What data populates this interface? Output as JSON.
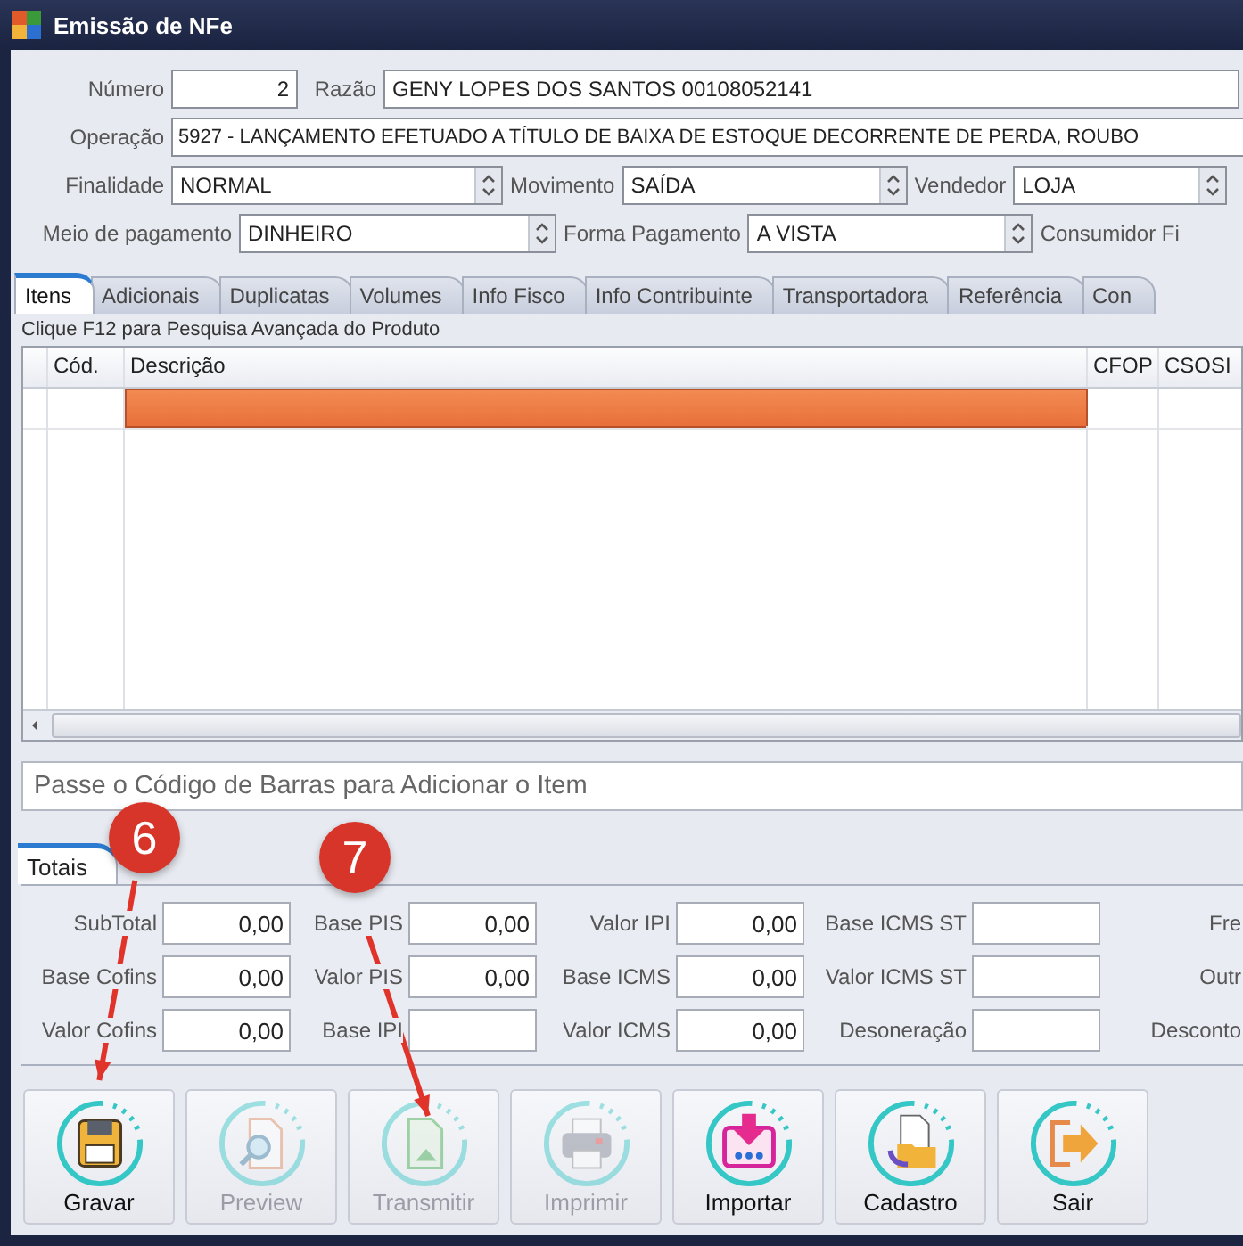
{
  "window": {
    "title": "Emissão de NFe"
  },
  "form": [
    [
      {
        "label": "Número",
        "value": "2",
        "kind": "number"
      },
      {
        "label": "Razão",
        "value": "GENY LOPES DOS SANTOS 00108052141",
        "kind": "text"
      }
    ],
    [
      {
        "label": "Operação",
        "value": "5927 - LANÇAMENTO EFETUADO A TÍTULO DE BAIXA DE ESTOQUE DECORRENTE DE PERDA, ROUBO",
        "kind": "text"
      }
    ],
    [
      {
        "label": "Finalidade",
        "value": "NORMAL",
        "kind": "select"
      },
      {
        "label": "Movimento",
        "value": "SAÍDA",
        "kind": "select"
      },
      {
        "label": "Vendedor",
        "value": "LOJA",
        "kind": "select"
      }
    ],
    [
      {
        "label": "Meio de pagamento",
        "value": "DINHEIRO",
        "kind": "select"
      },
      {
        "label": "Forma Pagamento",
        "value": "A VISTA",
        "kind": "select"
      },
      {
        "label": "Consumidor Fi",
        "kind": "label"
      }
    ]
  ],
  "tabs": [
    {
      "label": "Itens",
      "selected": true
    },
    {
      "label": "Adicionais",
      "selected": false
    },
    {
      "label": "Duplicatas",
      "selected": false
    },
    {
      "label": "Volumes",
      "selected": false
    },
    {
      "label": "Info Fisco",
      "selected": false
    },
    {
      "label": "Info Contribuinte",
      "selected": false
    },
    {
      "label": "Transportadora",
      "selected": false
    },
    {
      "label": "Referência",
      "selected": false
    },
    {
      "label": "Con",
      "selected": false
    }
  ],
  "hint": "Clique F12 para Pesquisa Avançada do Produto",
  "table": {
    "columns": [
      "Cód.",
      "Descrição",
      "CFOP",
      "CSOSI"
    ],
    "rows": [
      {
        "selected": true
      }
    ]
  },
  "barcode": {
    "placeholder": "Passe o Código de Barras  para Adicionar o Item"
  },
  "totals": {
    "tab": "Totais",
    "rows": [
      [
        {
          "label": "SubTotal",
          "value": "0,00",
          "kind": "field"
        },
        {
          "label": "Base PIS",
          "value": "0,00",
          "kind": "field"
        },
        {
          "label": "Valor IPI",
          "value": "0,00",
          "kind": "field"
        },
        {
          "label": "Base ICMS ST",
          "kind": "field"
        },
        {
          "label": "Fre",
          "kind": "label"
        }
      ],
      [
        {
          "label": "Base Cofins",
          "value": "0,00",
          "kind": "field"
        },
        {
          "label": "Valor PIS",
          "value": "0,00",
          "kind": "field"
        },
        {
          "label": "Base ICMS",
          "value": "0,00",
          "kind": "field"
        },
        {
          "label": "Valor ICMS ST",
          "kind": "field"
        },
        {
          "label": "Outr",
          "kind": "label"
        }
      ],
      [
        {
          "label": "Valor Cofins",
          "value": "0,00",
          "kind": "field"
        },
        {
          "label": "Base IPI",
          "kind": "field"
        },
        {
          "label": "Valor ICMS",
          "value": "0,00",
          "kind": "field"
        },
        {
          "label": "Desoneração",
          "kind": "field"
        },
        {
          "label": "Desconto",
          "kind": "label"
        }
      ]
    ]
  },
  "buttons": [
    {
      "label": "Gravar",
      "disabled": false
    },
    {
      "label": "Preview",
      "disabled": true
    },
    {
      "label": "Transmitir",
      "disabled": true
    },
    {
      "label": "Imprimir",
      "disabled": true
    },
    {
      "label": "Importar",
      "disabled": false
    },
    {
      "label": "Cadastro",
      "disabled": false
    },
    {
      "label": "Sair",
      "disabled": false
    }
  ],
  "annotations": [
    {
      "text": "6"
    },
    {
      "text": "7"
    }
  ]
}
